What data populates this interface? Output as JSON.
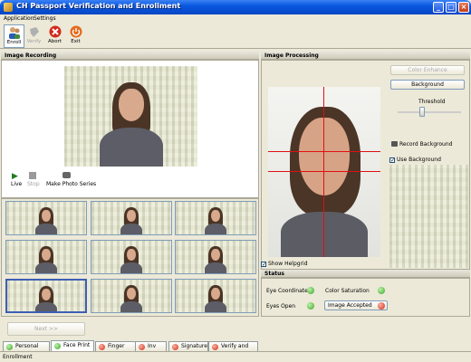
{
  "window": {
    "title": "CH Passport Verification and Enrollment"
  },
  "menu": [
    "Application",
    "Settings"
  ],
  "toolbar": {
    "enroll": "Enroll",
    "verify": "Verify",
    "abort": "Abort",
    "exit": "Exit"
  },
  "image_recording": {
    "title": "Image Recording",
    "live": "Live",
    "stop": "Stop",
    "make_photo_series": "Make Photo Series"
  },
  "image_processing": {
    "title": "Image Processing",
    "color_enhance": "Color Enhance",
    "background": "Background",
    "threshold": "Threshold",
    "record_background": "Record Background",
    "use_background": "Use Background",
    "show_helpgrid": "Show Helpgrid",
    "use_background_checked": true,
    "show_helpgrid_checked": true
  },
  "status": {
    "title": "Status",
    "eye_coordinates": "Eye Coordinates",
    "eyes_open": "Eyes Open",
    "color_saturation": "Color Saturation",
    "image_accepted": "Image Accepted",
    "states": {
      "eye_coordinates": "ok",
      "eyes_open": "ok",
      "color_saturation": "ok",
      "image_accepted": "bad"
    }
  },
  "next_button": "Next >>",
  "tabs": [
    {
      "label": "Personal Data",
      "state": "ok"
    },
    {
      "label": "Face Print",
      "state": "ok"
    },
    {
      "label": "Finger Print",
      "state": "bad"
    },
    {
      "label": "Inv",
      "state": "bad"
    },
    {
      "label": "Signature",
      "state": "bad"
    },
    {
      "label": "Verify and Save",
      "state": "bad"
    }
  ],
  "statusbar": "Enrollment",
  "colors": {
    "ok": "#3fa12c",
    "bad": "#d32b13",
    "title_blue": "#0a58e0"
  }
}
